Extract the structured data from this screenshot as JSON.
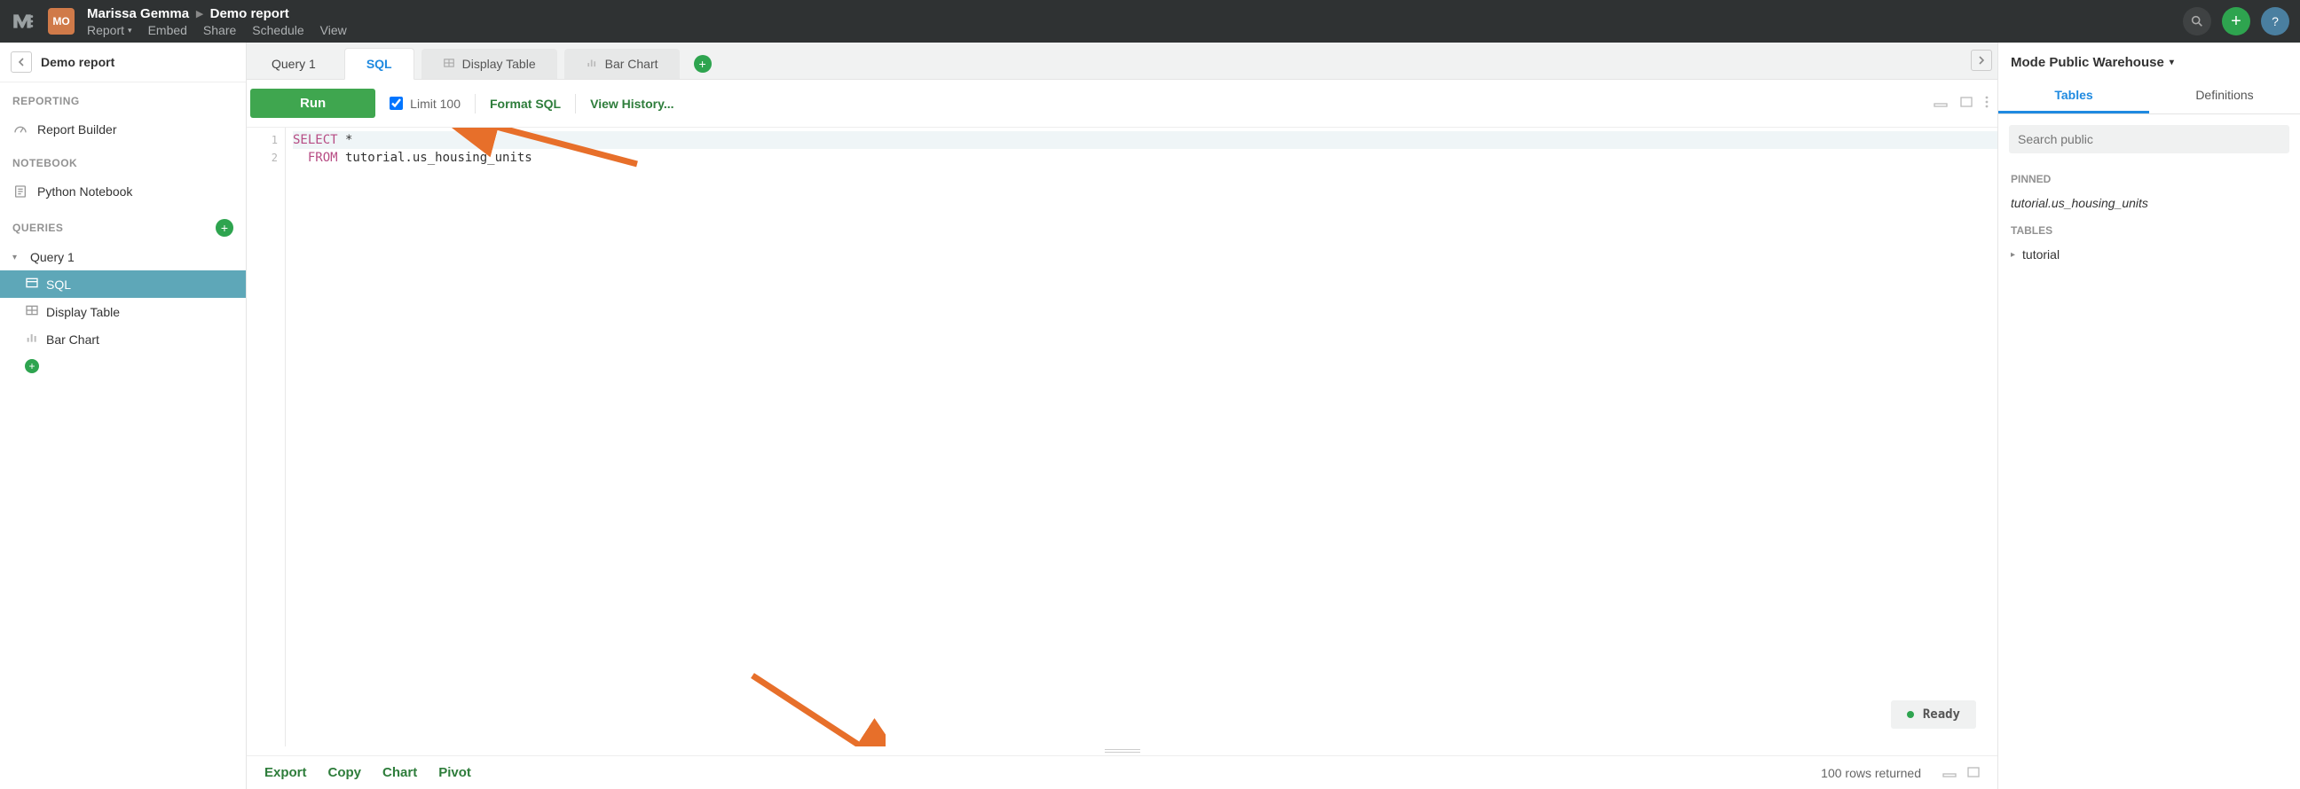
{
  "header": {
    "user_initials": "MO",
    "user_name": "Marissa Gemma",
    "report_name": "Demo report",
    "menus": {
      "report": "Report",
      "embed": "Embed",
      "share": "Share",
      "schedule": "Schedule",
      "view": "View"
    }
  },
  "sidebar": {
    "title": "Demo report",
    "sections": {
      "reporting": "REPORTING",
      "notebook": "NOTEBOOK",
      "queries": "QUERIES"
    },
    "report_builder": "Report Builder",
    "python_notebook": "Python Notebook",
    "query_1": "Query 1",
    "sql": "SQL",
    "display_table": "Display Table",
    "bar_chart": "Bar Chart"
  },
  "tabs": {
    "query_1": "Query 1",
    "sql": "SQL",
    "display_table": "Display Table",
    "bar_chart": "Bar Chart"
  },
  "toolbar": {
    "run": "Run",
    "limit_label": "Limit 100",
    "format_sql": "Format SQL",
    "view_history": "View History..."
  },
  "code": {
    "line1_kw": "SELECT",
    "line1_rest": " *",
    "line2_kw": "  FROM",
    "line2_rest": " tutorial.us_housing_units",
    "linenos": [
      "1",
      "2"
    ]
  },
  "status": {
    "ready": "Ready"
  },
  "footer": {
    "export": "Export",
    "copy": "Copy",
    "chart": "Chart",
    "pivot": "Pivot",
    "rows": "100 rows returned"
  },
  "right": {
    "warehouse": "Mode Public Warehouse",
    "tab_tables": "Tables",
    "tab_definitions": "Definitions",
    "search_placeholder": "Search public",
    "pinned_label": "PINNED",
    "pinned_item_prefix": "tutorial",
    "pinned_item_suffix": ".us_housing_units",
    "tables_label": "TABLES",
    "tree_tutorial": "tutorial"
  }
}
